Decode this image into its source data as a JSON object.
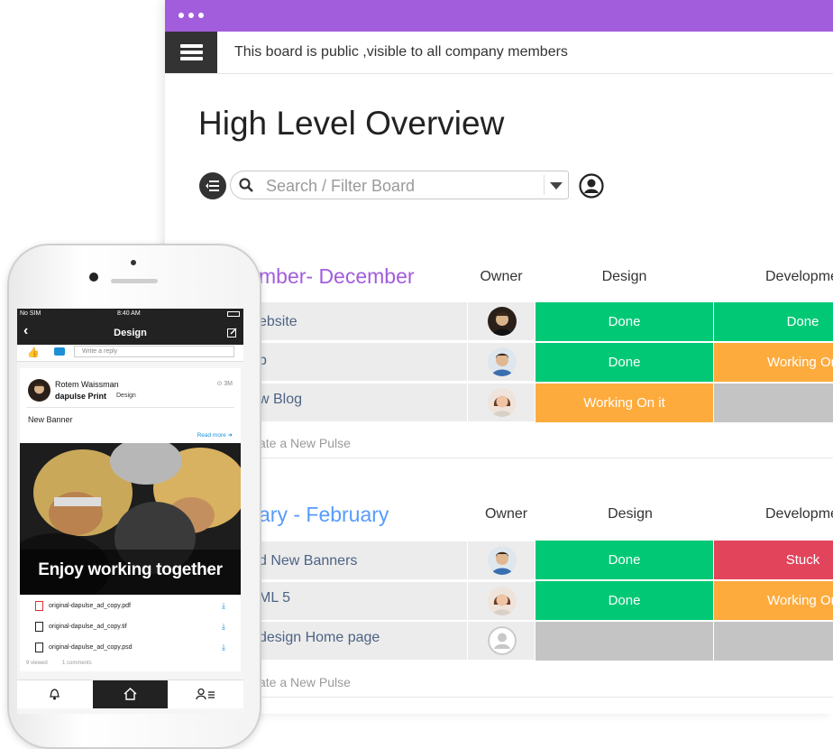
{
  "board": {
    "public_notice": "This board is public ,visible to all company members",
    "title": "High Level Overview",
    "search_placeholder": "Search / Filter Board"
  },
  "groups": [
    {
      "title": "mber- December",
      "color": "#a25ddc",
      "columns": [
        "Owner",
        "Design",
        "Developme"
      ],
      "rows": [
        {
          "name": "ebsite",
          "design": "Done",
          "dev": "Done"
        },
        {
          "name": "p",
          "design": "Done",
          "dev": "Working On"
        },
        {
          "name": "w Blog",
          "design": "Working On it",
          "dev": ""
        }
      ],
      "new_pulse": "ate a New Pulse"
    },
    {
      "title": "ary - February",
      "color": "#579bfc",
      "columns": [
        "Owner",
        "Design",
        "Developme"
      ],
      "rows": [
        {
          "name": "d New Banners",
          "design": "Done",
          "dev": "Stuck"
        },
        {
          "name": "ML 5",
          "design": "Done",
          "dev": "Working On"
        },
        {
          "name": "design Home page",
          "design": "",
          "dev": ""
        }
      ],
      "new_pulse": "ate a New Pulse"
    }
  ],
  "status_colors": {
    "done": "#00c875",
    "working": "#fdab3d",
    "stuck": "#e2445c",
    "empty": "#c4c4c4"
  },
  "phone": {
    "carrier": "No SIM",
    "time": "8:40 AM",
    "nav_title": "Design",
    "reply_placeholder": "Write a reply",
    "author": "Rotem Waissman",
    "board_name": "dapulse Print",
    "group_name": "Design",
    "age": "3M",
    "post_title": "New Banner",
    "read_more": "Read more",
    "banner_caption": "Enjoy working together",
    "files": [
      "original-dapulse_ad_copy.pdf",
      "original-dapulse_ad_copy.tif",
      "original-dapulse_ad_copy.psd"
    ],
    "views": "9 viewed",
    "comments": "1 comments"
  }
}
